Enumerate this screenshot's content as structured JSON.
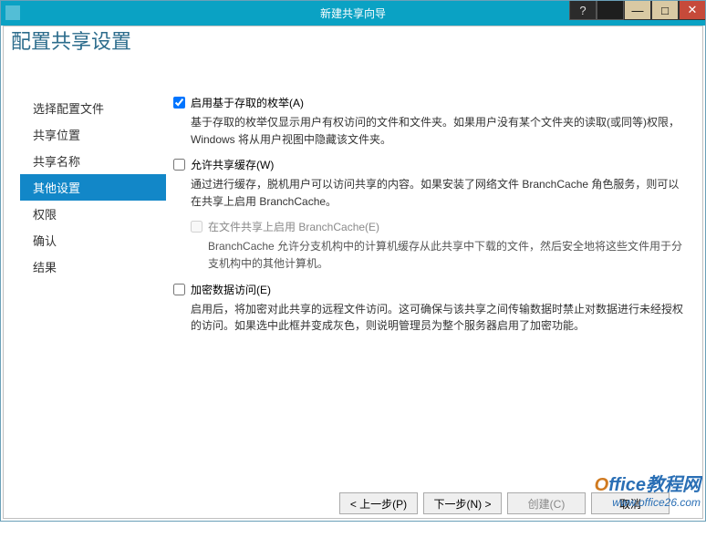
{
  "window": {
    "title": "新建共享向导"
  },
  "page": {
    "heading": "配置共享设置"
  },
  "sidebar": {
    "items": [
      {
        "label": "选择配置文件"
      },
      {
        "label": "共享位置"
      },
      {
        "label": "共享名称"
      },
      {
        "label": "其他设置"
      },
      {
        "label": "权限"
      },
      {
        "label": "确认"
      },
      {
        "label": "结果"
      }
    ]
  },
  "options": {
    "abe": {
      "label": "启用基于存取的枚举(A)",
      "desc": "基于存取的枚举仅显示用户有权访问的文件和文件夹。如果用户没有某个文件夹的读取(或同等)权限，Windows 将从用户视图中隐藏该文件夹。"
    },
    "cache": {
      "label": "允许共享缓存(W)",
      "desc": "通过进行缓存，脱机用户可以访问共享的内容。如果安装了网络文件 BranchCache 角色服务，则可以在共享上启用 BranchCache。"
    },
    "branch": {
      "label": "在文件共享上启用 BranchCache(E)",
      "desc": "BranchCache 允许分支机构中的计算机缓存从此共享中下载的文件，然后安全地将这些文件用于分支机构中的其他计算机。"
    },
    "encrypt": {
      "label": "加密数据访问(E)",
      "desc": "启用后，将加密对此共享的远程文件访问。这可确保与该共享之间传输数据时禁止对数据进行未经授权的访问。如果选中此框并变成灰色，则说明管理员为整个服务器启用了加密功能。"
    }
  },
  "buttons": {
    "prev": "< 上一步(P)",
    "next": "下一步(N) >",
    "create": "创建(C)",
    "cancel": "取消"
  },
  "watermark": {
    "brand_o": "O",
    "brand_rest": "ffice教程网",
    "url": "www.office26.com"
  }
}
